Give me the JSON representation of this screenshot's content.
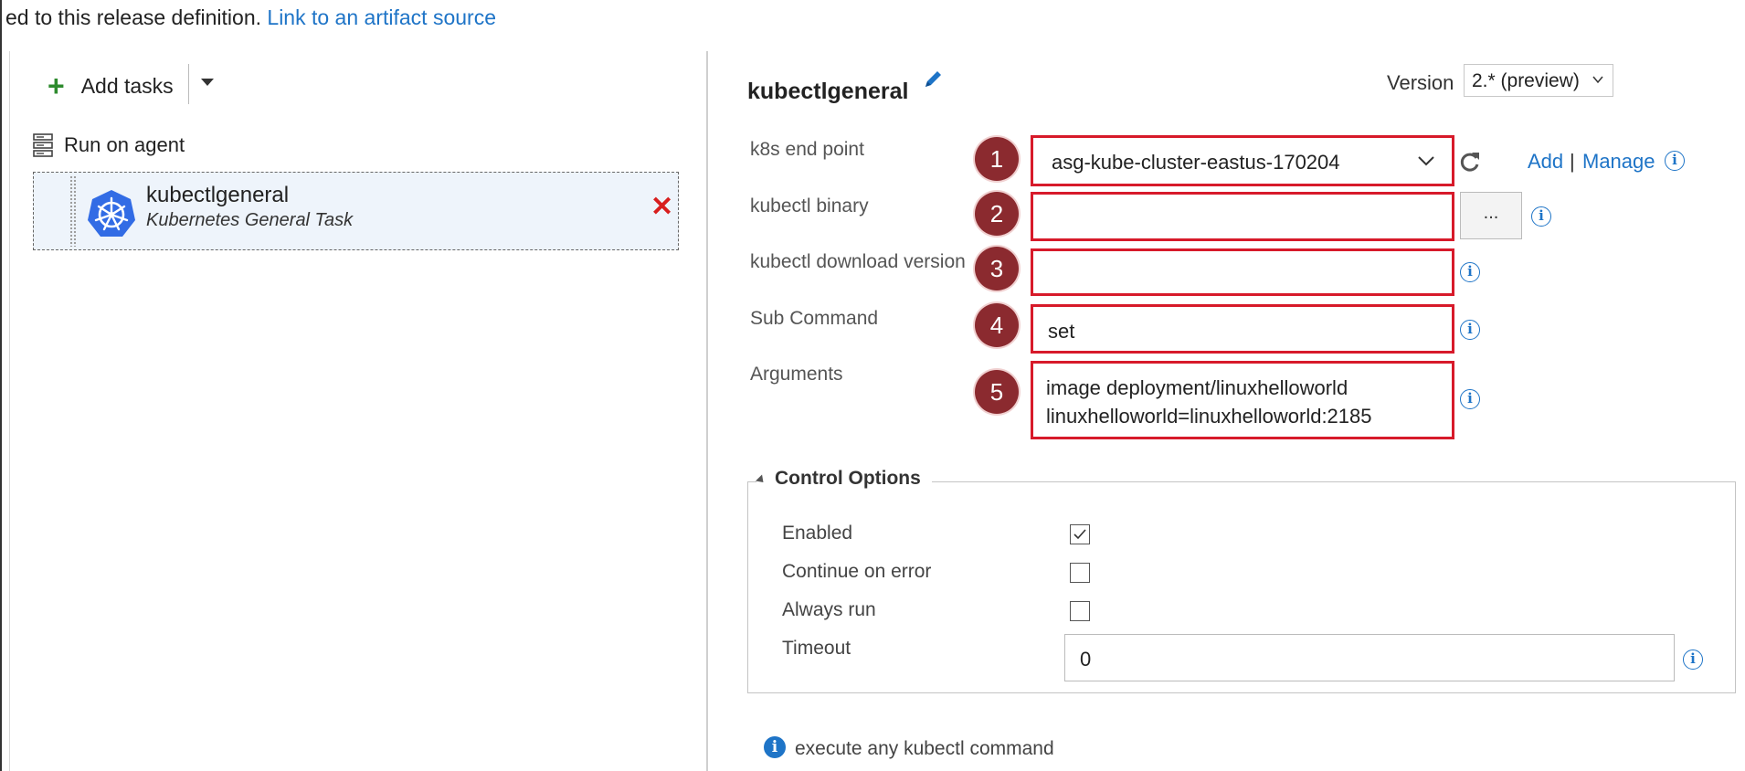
{
  "banner": {
    "prefix_text": "ed to this release definition.",
    "link_text": "Link to an artifact source"
  },
  "left": {
    "add_tasks_label": "Add tasks",
    "run_on_agent_label": "Run on agent",
    "task": {
      "name": "kubectlgeneral",
      "subtitle": "Kubernetes General Task"
    }
  },
  "task_editor": {
    "title": "kubectlgeneral",
    "version_label": "Version",
    "version_value": "2.* (preview)",
    "fields": [
      {
        "label": "k8s end point",
        "badge": "1",
        "value": "asg-kube-cluster-eastus-170204"
      },
      {
        "label": "kubectl binary",
        "badge": "2",
        "value": ""
      },
      {
        "label": "kubectl download version",
        "badge": "3",
        "value": ""
      },
      {
        "label": "Sub Command",
        "badge": "4",
        "value": "set"
      },
      {
        "label": "Arguments",
        "badge": "5",
        "value_line1": "image deployment/linuxhelloworld",
        "value_line2": "linuxhelloworld=linuxhelloworld:2185"
      }
    ],
    "ellipsis_label": "...",
    "add_link": "Add",
    "separator": "|",
    "manage_link": "Manage",
    "info_glyph": "i"
  },
  "control_options": {
    "title": "Control Options",
    "enabled_label": "Enabled",
    "enabled_checked": true,
    "continue_on_error_label": "Continue on error",
    "continue_on_error_checked": false,
    "always_run_label": "Always run",
    "always_run_checked": false,
    "timeout_label": "Timeout",
    "timeout_value": "0"
  },
  "footer": {
    "description": "execute any kubectl command"
  },
  "colors": {
    "accent_blue": "#1e74c7",
    "highlight_red": "#d71a2a",
    "badge_maroon": "#8b2a2f",
    "add_green": "#2e8b2e"
  }
}
